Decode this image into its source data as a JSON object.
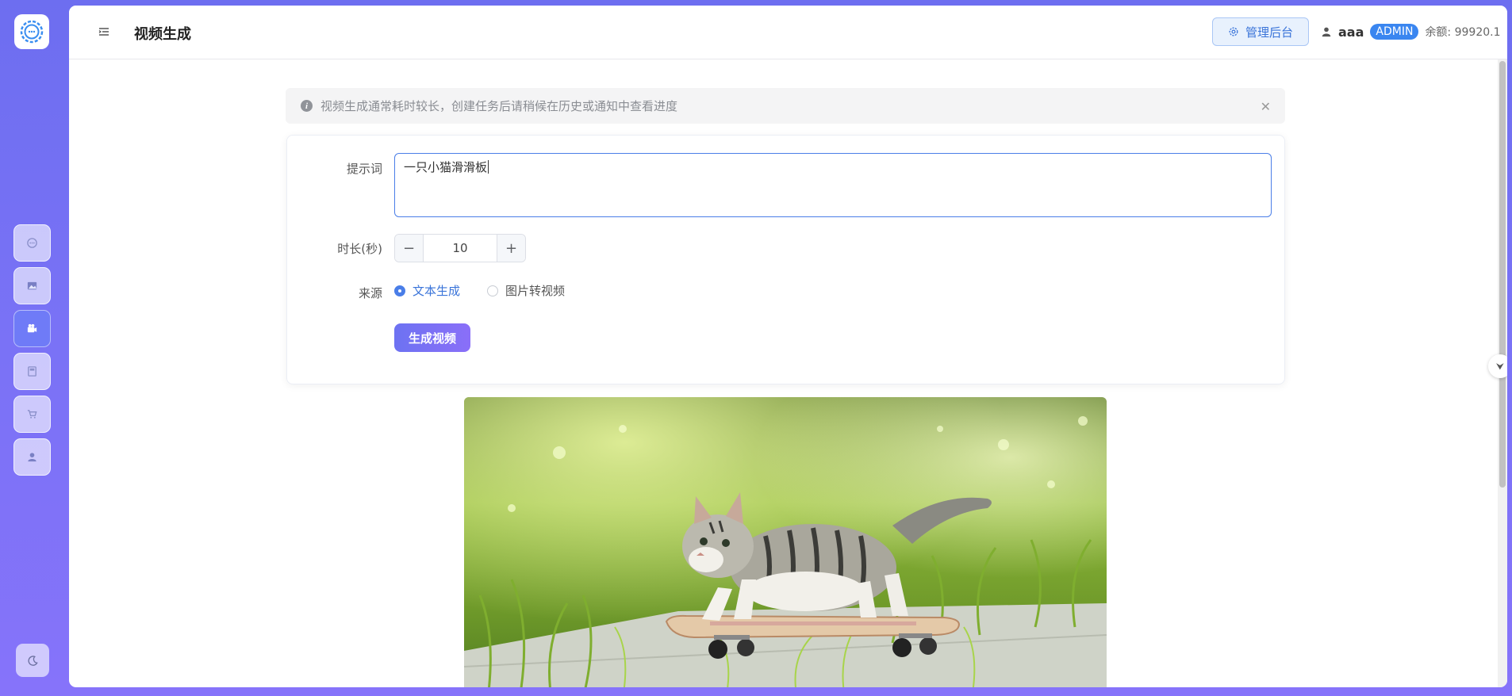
{
  "header": {
    "title": "视频生成",
    "admin_button": "管理后台",
    "username": "aaa",
    "role": "ADMIN",
    "balance": "余额: 99920.1"
  },
  "rail": {
    "items": [
      {
        "icon": "chat-icon"
      },
      {
        "icon": "image-icon"
      },
      {
        "icon": "video-icon",
        "active": true
      },
      {
        "icon": "document-icon"
      },
      {
        "icon": "cart-icon"
      },
      {
        "icon": "user-icon"
      }
    ],
    "theme_icon": "moon-icon"
  },
  "alert": {
    "text": "视频生成通常耗时较长，创建任务后请稍候在历史或通知中查看进度"
  },
  "form": {
    "prompt_label": "提示词",
    "prompt_value": "一只小猫滑滑板",
    "duration_label": "时长(秒)",
    "duration_value": "10",
    "source_label": "来源",
    "source_options": [
      "文本生成",
      "图片转视频"
    ],
    "source_selected": "文本生成",
    "submit_label": "生成视频"
  },
  "colors": {
    "accent": "#4a7ee8",
    "brand_gradient_start": "#6d72f2",
    "brand_gradient_end": "#8a6ff8"
  }
}
